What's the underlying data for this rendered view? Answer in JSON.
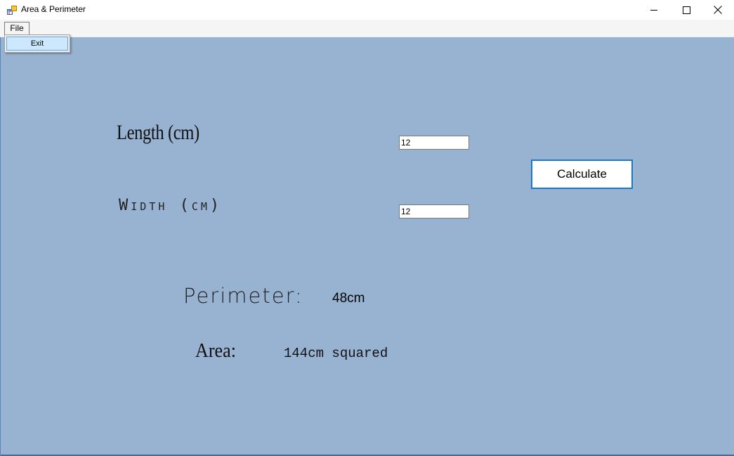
{
  "window": {
    "title": "Area & Perimeter"
  },
  "menu": {
    "file_label": "File",
    "file_items": [
      "Exit"
    ]
  },
  "form": {
    "length_label": "Length (cm)",
    "width_label": "Width (cm)",
    "length_value": "12",
    "width_value": "12",
    "calculate_label": "Calculate",
    "perimeter_label": "Perimeter:",
    "perimeter_value": "48cm",
    "area_label": "Area:",
    "area_value": "144cm squared"
  },
  "colors": {
    "form_background": "#98b2d1",
    "button_border": "#1979ca",
    "menu_highlight": "#cce8ff"
  },
  "icons": {
    "app": "app-icon",
    "minimize": "minimize-icon",
    "maximize": "maximize-icon",
    "close": "close-icon"
  }
}
